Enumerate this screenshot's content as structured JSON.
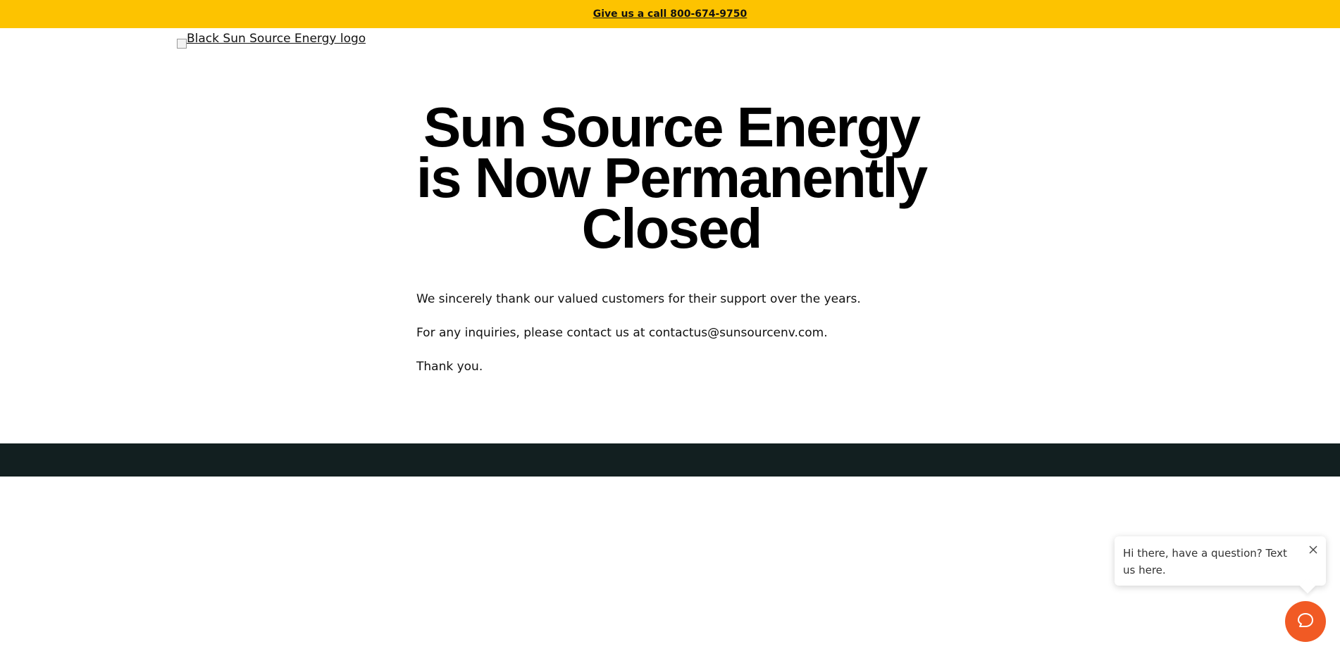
{
  "topbar": {
    "call_text": "Give us a call 800-674-9750",
    "background_color": "#fdc300"
  },
  "header": {
    "logo_alt": "Black Sun Source Energy logo",
    "logo_icon": "broken-image-icon"
  },
  "main": {
    "headline": "Sun Source Energy is Now Permanently Closed",
    "paragraphs": [
      "We sincerely thank our valued customers for their support over the years.",
      "For any inquiries, please contact us at contactus@sunsourcenv.com.",
      "Thank you."
    ]
  },
  "footer": {
    "background_color": "#121f20"
  },
  "chat_widget": {
    "prompt_text": "Hi there, have a question? Text us here.",
    "close_icon": "close-icon",
    "launcher_icon": "chat-bubble-icon",
    "launcher_color": "#f15a24"
  }
}
